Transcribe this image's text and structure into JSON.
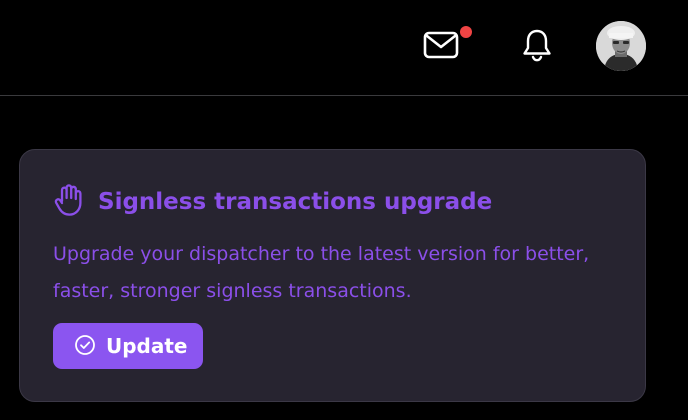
{
  "header": {
    "icons": [
      "mail-icon",
      "bell-icon",
      "avatar"
    ],
    "notification_dot_color": "#ef4444"
  },
  "card": {
    "icon": "hand-icon",
    "title": "Signless transactions upgrade",
    "description": "Upgrade your dispatcher to the latest version for better, faster, stronger signless transactions.",
    "button": {
      "icon": "check-circle-icon",
      "label": "Update"
    },
    "accent_color": "#8b4fe9"
  }
}
